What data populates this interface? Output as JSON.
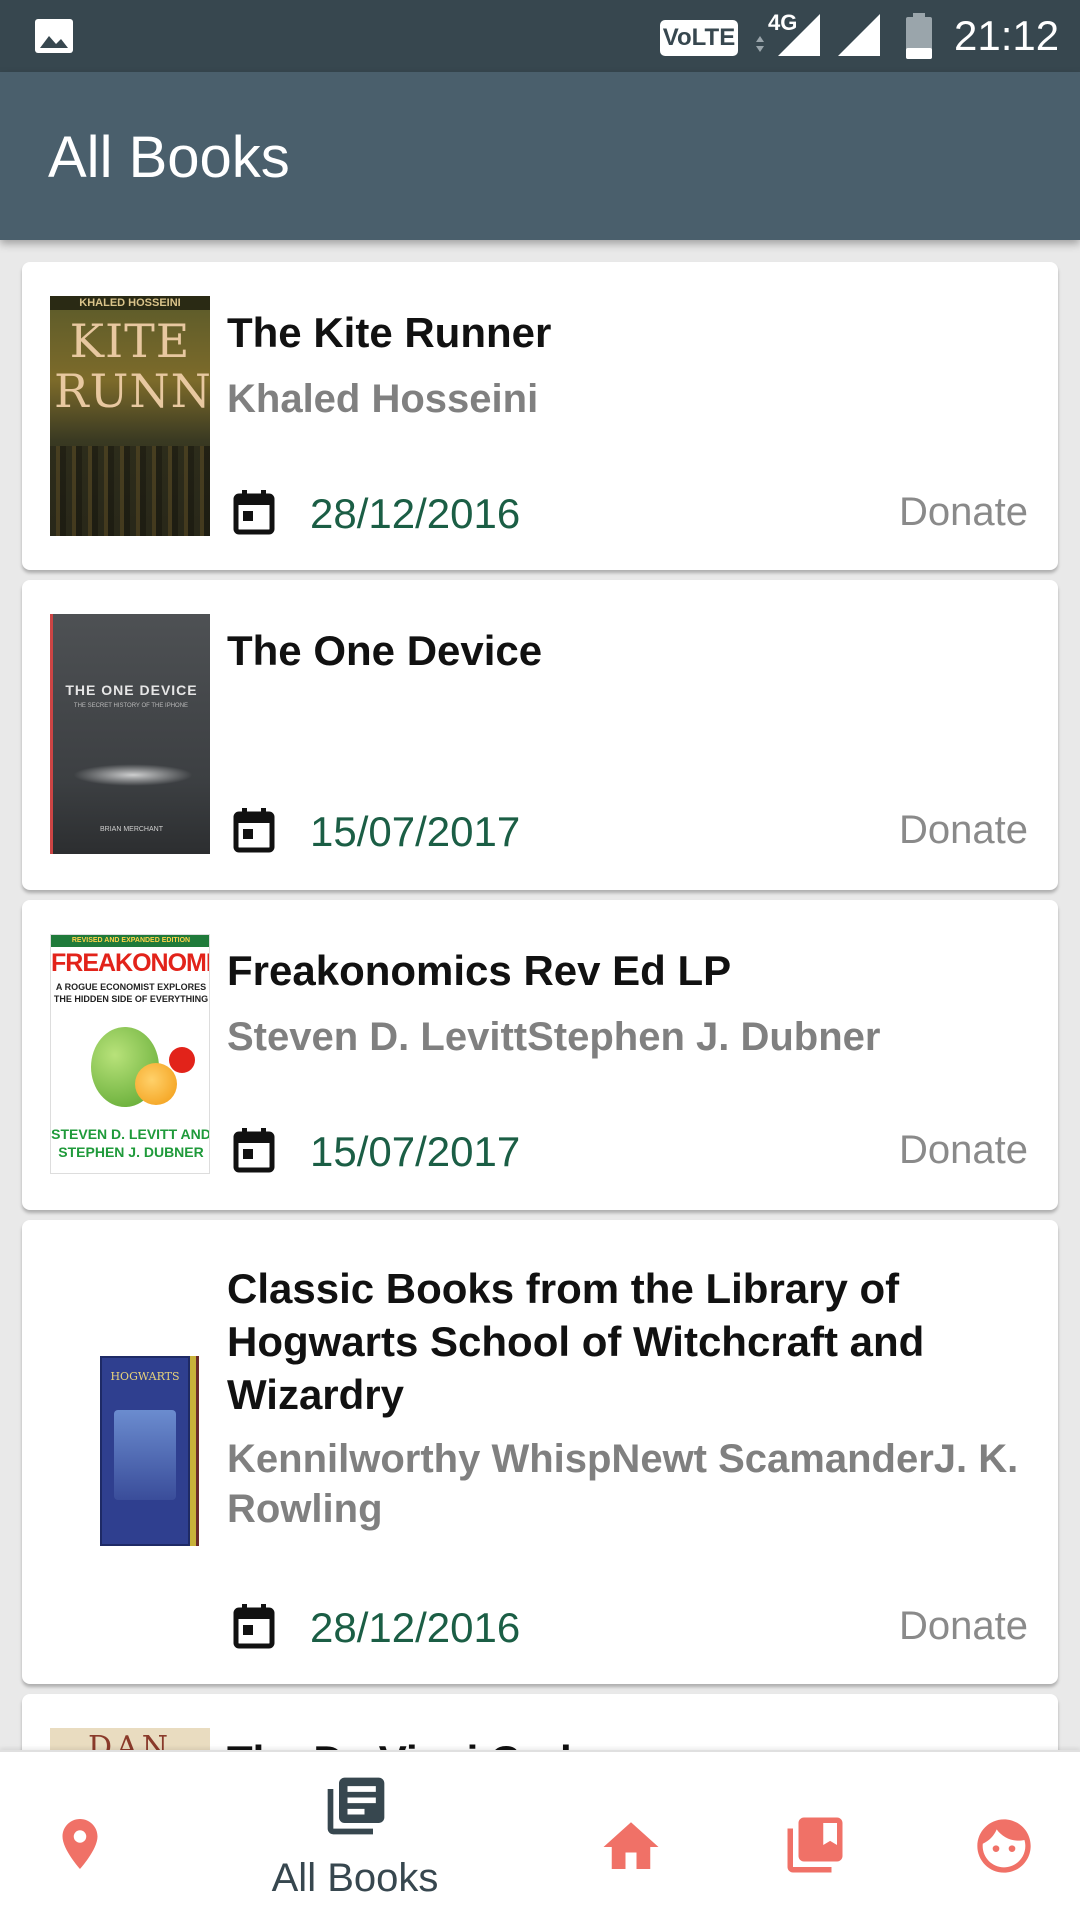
{
  "status_bar": {
    "network_badge": "VoLTE",
    "network_type": "4G",
    "time": "21:12"
  },
  "app_bar": {
    "title": "All Books"
  },
  "books": [
    {
      "title": "The Kite Runner",
      "author": "Khaled Hosseini",
      "date": "28/12/2016",
      "action": "Donate",
      "cover_title": "KITE RUNNER",
      "cover_author": "KHALED HOSSEINI"
    },
    {
      "title": "The One Device",
      "author": "",
      "date": "15/07/2017",
      "action": "Donate",
      "cover_title": "THE ONE DEVICE",
      "cover_subtitle": "THE SECRET HISTORY OF THE IPHONE",
      "cover_author": "BRIAN MERCHANT"
    },
    {
      "title": "Freakonomics Rev Ed LP",
      "author": "Steven D. LevittStephen J. Dubner",
      "date": "15/07/2017",
      "action": "Donate",
      "cover_banner": "REVISED AND EXPANDED EDITION",
      "cover_title": "FREAKONOMICS",
      "cover_tagline": "A ROGUE ECONOMIST EXPLORES THE HIDDEN SIDE OF EVERYTHING",
      "cover_author": "STEVEN D. LEVITT AND STEPHEN J. DUBNER"
    },
    {
      "title": "Classic Books from the Library of Hogwarts School of Witchcraft and Wizardry",
      "author": "Kennilworthy WhispNewt ScamanderJ. K. Rowling",
      "date": "28/12/2016",
      "action": "Donate",
      "cover_title": "HOGWARTS"
    },
    {
      "title": "The Da Vinci Code",
      "cover_title": "DAN"
    }
  ],
  "bottom_nav": {
    "items": [
      {
        "icon": "location-pin-icon",
        "label": ""
      },
      {
        "icon": "library-books-icon",
        "label": "All Books"
      },
      {
        "icon": "home-icon",
        "label": ""
      },
      {
        "icon": "bookmark-collection-icon",
        "label": ""
      },
      {
        "icon": "face-icon",
        "label": ""
      }
    ],
    "active_color": "#37474f",
    "inactive_color": "#f07167"
  },
  "colors": {
    "status_bar": "#37474f",
    "app_bar": "#4a5f6c",
    "date_text": "#1b5e45",
    "accent": "#f07167"
  }
}
